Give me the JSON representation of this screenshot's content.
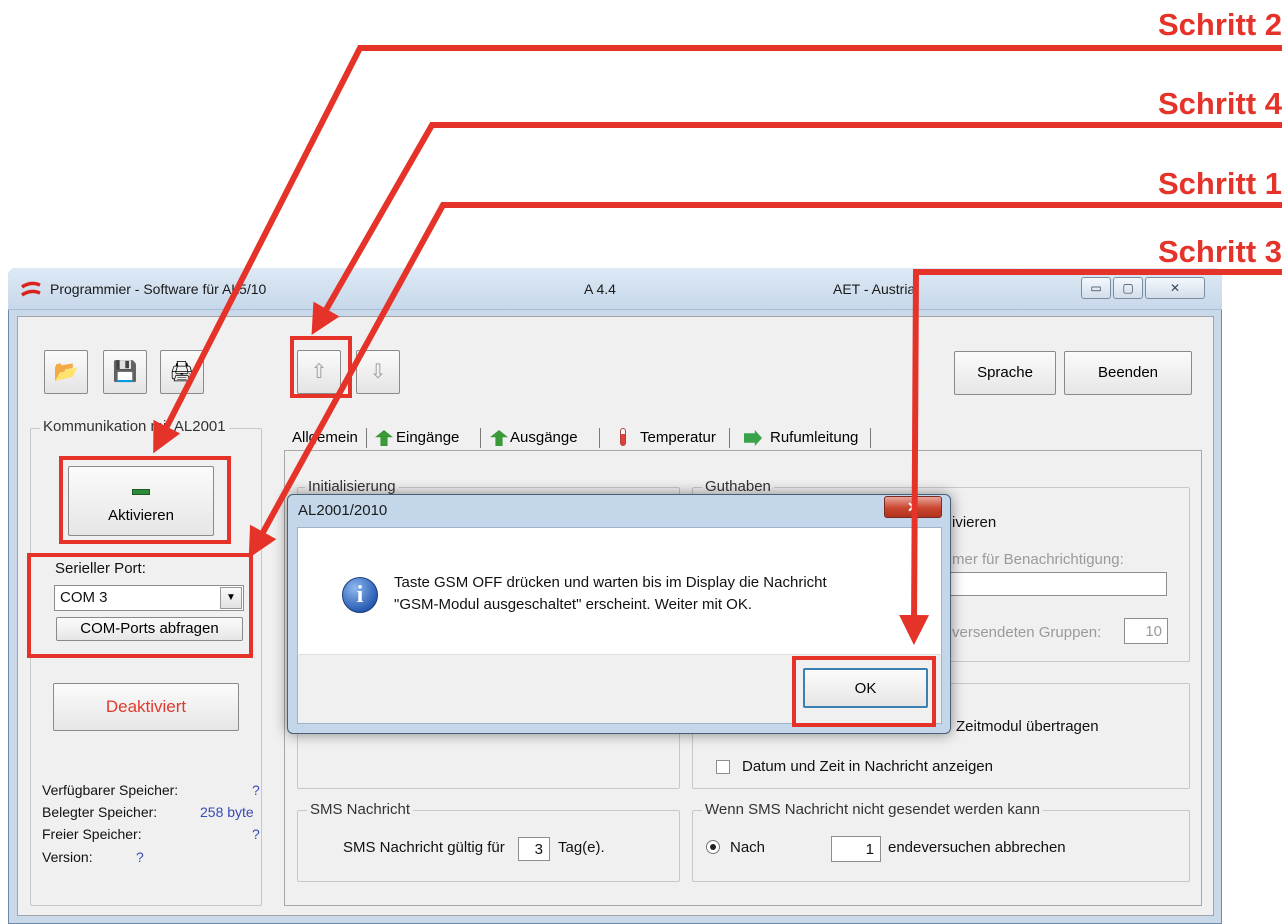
{
  "steps": {
    "s2": "Schritt 2",
    "s4": "Schritt 4",
    "s1": "Schritt 1",
    "s3": "Schritt 3"
  },
  "window": {
    "title": "Programmier - Software für AL5/10",
    "version": "A 4.4",
    "company": "AET - Austria",
    "minimize_glyph": "▭",
    "maximize_glyph": "▢",
    "close_glyph": "✕"
  },
  "toolbar": {
    "open_icon": "📂",
    "save_icon": "💾",
    "print_icon": "🖨",
    "upload_icon": "⇧",
    "download_icon": "⇩",
    "sprache": "Sprache",
    "beenden": "Beenden"
  },
  "left": {
    "group_title": "Kommunikation mit AL2001",
    "aktivieren": "Aktivieren",
    "port_label": "Serieller Port:",
    "port_value": "COM 3",
    "com_abfragen": "COM-Ports abfragen",
    "deaktiviert": "Deaktiviert",
    "verfuegbar_label": "Verfügbarer Speicher:",
    "verfuegbar_value": "?",
    "belegt_label": "Belegter Speicher:",
    "belegt_value": "258 byte",
    "frei_label": "Freier Speicher:",
    "frei_value": "?",
    "version_label": "Version:",
    "version_value": "?"
  },
  "tabs": [
    "Allgemein",
    "Eingänge",
    "Ausgänge",
    "Temperatur",
    "Rufumleitung"
  ],
  "panel": {
    "init_title": "Initialisierung",
    "guthaben_title": "Guthaben",
    "aktivieren_partial": "ivieren",
    "nummer_partial": "mer für Benachrichtigung:",
    "gruppen_partial": "versendeten Gruppen:",
    "gruppen_value": "10",
    "zeitmodul_partial": "Zeitmodul übertragen",
    "datum_zeit": "Datum und Zeit in Nachricht anzeigen",
    "sms_title": "SMS Nachricht",
    "sms_gueltig": "SMS Nachricht gültig für",
    "sms_value": "3",
    "sms_unit": "Tag(e).",
    "wenn_title": "Wenn SMS Nachricht nicht gesendet werden kann",
    "nach": "Nach",
    "nach_value": "1",
    "sendeversuchen_partial": "endeversuchen abbrechen"
  },
  "dialog": {
    "title": "AL2001/2010",
    "line1": "Taste GSM OFF drücken und warten bis im Display die Nachricht",
    "line2": "\"GSM-Modul ausgeschaltet\" erscheint. Weiter mit OK.",
    "ok": "OK",
    "close_glyph": "✕",
    "info_glyph": "i"
  },
  "colors": {
    "annotation_red": "#e5332a",
    "deaktiviert_red": "#e03a2e"
  }
}
